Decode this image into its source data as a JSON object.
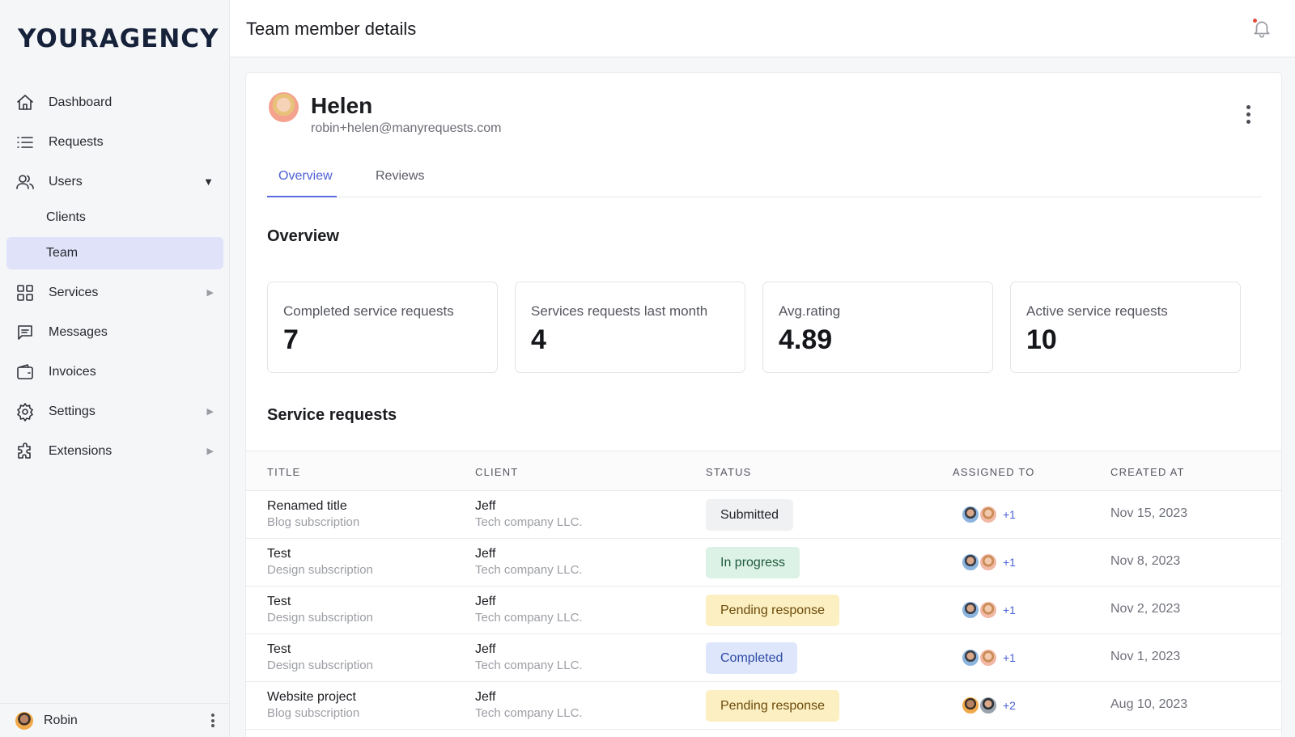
{
  "app": {
    "logo": "YOURAGENCY",
    "page_title": "Team member details"
  },
  "sidebar": {
    "items": [
      {
        "label": "Dashboard",
        "icon": "home-icon"
      },
      {
        "label": "Requests",
        "icon": "list-icon"
      },
      {
        "label": "Users",
        "icon": "users-icon",
        "expanded": true
      },
      {
        "label": "Services",
        "icon": "grid-icon"
      },
      {
        "label": "Messages",
        "icon": "chat-icon"
      },
      {
        "label": "Invoices",
        "icon": "wallet-icon"
      },
      {
        "label": "Settings",
        "icon": "gear-icon"
      },
      {
        "label": "Extensions",
        "icon": "puzzle-icon"
      }
    ],
    "users_sub": [
      {
        "label": "Clients",
        "active": false
      },
      {
        "label": "Team",
        "active": true
      }
    ],
    "current_user": "Robin"
  },
  "profile": {
    "name": "Helen",
    "email": "robin+helen@manyrequests.com"
  },
  "tabs": [
    {
      "label": "Overview",
      "active": true
    },
    {
      "label": "Reviews",
      "active": false
    }
  ],
  "overview": {
    "title": "Overview",
    "stats": [
      {
        "label": "Completed service requests",
        "value": "7"
      },
      {
        "label": "Services requests last month",
        "value": "4"
      },
      {
        "label": "Avg.rating",
        "value": "4.89"
      },
      {
        "label": "Active service requests",
        "value": "10"
      }
    ]
  },
  "requests": {
    "title": "Service requests",
    "columns": [
      "TITLE",
      "CLIENT",
      "STATUS",
      "ASSIGNED TO",
      "CREATED AT"
    ],
    "rows": [
      {
        "title": "Renamed title",
        "subtitle": "Blog subscription",
        "client": "Jeff",
        "company": "Tech company LLC.",
        "status": "Submitted",
        "assigned_more": "+1",
        "created": "Nov 15, 2023"
      },
      {
        "title": "Test",
        "subtitle": "Design subscription",
        "client": "Jeff",
        "company": "Tech company LLC.",
        "status": "In progress",
        "assigned_more": "+1",
        "created": "Nov 8, 2023"
      },
      {
        "title": "Test",
        "subtitle": "Design subscription",
        "client": "Jeff",
        "company": "Tech company LLC.",
        "status": "Pending response",
        "assigned_more": "+1",
        "created": "Nov 2, 2023"
      },
      {
        "title": "Test",
        "subtitle": "Design subscription",
        "client": "Jeff",
        "company": "Tech company LLC.",
        "status": "Completed",
        "assigned_more": "+1",
        "created": "Nov 1, 2023"
      },
      {
        "title": "Website project",
        "subtitle": "Blog subscription",
        "client": "Jeff",
        "company": "Tech company LLC.",
        "status": "Pending response",
        "assigned_more": "+2",
        "created": "Aug 10, 2023"
      }
    ]
  },
  "status_colors": {
    "Submitted": {
      "bg": "#f0f1f3",
      "fg": "#23252b"
    },
    "In progress": {
      "bg": "#dcf2e6",
      "fg": "#1f5a3a"
    },
    "Pending response": {
      "bg": "#fcefc1",
      "fg": "#6b4a0a"
    },
    "Completed": {
      "bg": "#dde6fb",
      "fg": "#2e4aa6"
    }
  },
  "colors": {
    "accent": "#4d5fd6",
    "active_nav": "#dfe2f8"
  }
}
